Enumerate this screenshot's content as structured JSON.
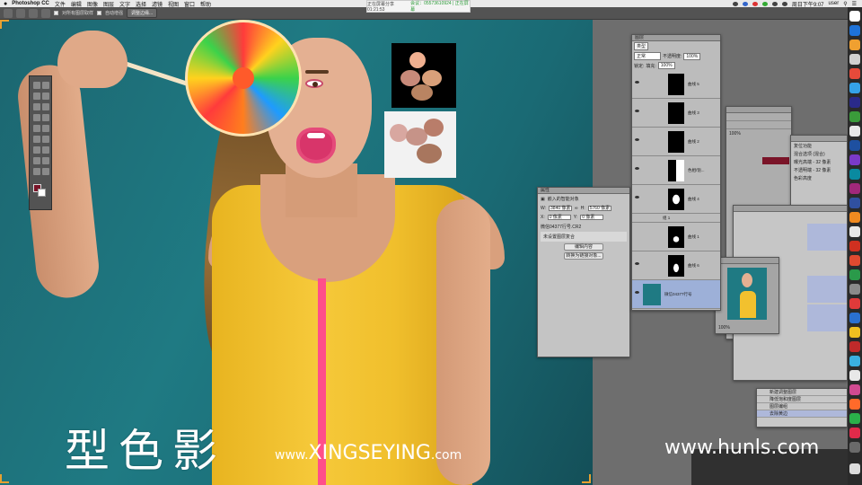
{
  "menubar": {
    "app": "Photoshop CC",
    "items": [
      "文件",
      "编辑",
      "图像",
      "图层",
      "文字",
      "选择",
      "滤镜",
      "视图",
      "窗口",
      "帮助"
    ],
    "clock": "周日下午9:07",
    "user": "user"
  },
  "share_banner": {
    "label": "正在屏幕分享 01:21:53",
    "id": "会议：05573610924 | 正在屏幕"
  },
  "optbar": {
    "option1": "对所有图层取样",
    "option2": "自动增强",
    "button": "调整边缘..."
  },
  "overlay": {
    "brand": "型色影",
    "site_prefix": "www.",
    "site_main": "XINGSEYING",
    "site_suffix": ".com",
    "watermark": "www.hunls.com"
  },
  "properties_panel": {
    "title": "属性",
    "subtitle": "嵌入的智能对象",
    "w_label": "W:",
    "w_value": "3840 像素",
    "h_label": "H:",
    "h_value": "5760 像素",
    "x_label": "X:",
    "x_value": "0 像素",
    "y_label": "Y:",
    "y_value": "0 像素",
    "file": "微信04377行号.CR2",
    "placeholder": "未设置图层复合",
    "button1": "编辑内容",
    "button2": "转换为链接对象..."
  },
  "layers_panel": {
    "title": "图层",
    "kind": "类型",
    "mode": "正常",
    "opacity_label": "不透明度:",
    "opacity": "100%",
    "fill_label": "填充:",
    "fill": "100%",
    "lock_label": "锁定:",
    "layers": [
      "曲线 5",
      "曲线 3",
      "曲线 2",
      "色相/饱...",
      "曲线 4",
      "组 1",
      "曲线 1",
      "曲线 6",
      "微信04377行号"
    ]
  },
  "mid_panel": {
    "zoom": "100%"
  },
  "history_panel": {
    "items": [
      "复位功能",
      "混合选项 (混合)",
      "曝光高端 - 32 像素",
      "不透明端 - 32 像素",
      "色彩高度"
    ]
  },
  "navigator": {
    "zoom": "100%"
  },
  "actions_panel": {
    "items": [
      "新建调整图层",
      "降低饱和度图层",
      "图层编组",
      "去除黄边"
    ]
  }
}
